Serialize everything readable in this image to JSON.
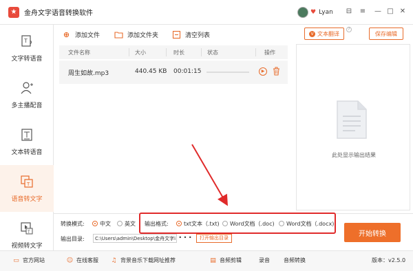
{
  "app": {
    "logo_text": "★",
    "title": "金舟文字语音转换软件",
    "user_name": "Lyan"
  },
  "window_controls": {
    "skin": "⊟",
    "menu": "≡",
    "minimize": "—",
    "maximize": "□",
    "close": "✕"
  },
  "sidebar": {
    "items": [
      {
        "label": "文字转语音",
        "icon": "text-to-speech-icon"
      },
      {
        "label": "多主播配音",
        "icon": "multi-speaker-icon"
      },
      {
        "label": "文本转语音",
        "icon": "document-to-speech-icon"
      },
      {
        "label": "语音转文字",
        "icon": "speech-to-text-icon",
        "active": true
      },
      {
        "label": "视频转文字",
        "icon": "video-to-text-icon"
      }
    ]
  },
  "toolbar": {
    "add_file": "添加文件",
    "add_folder": "添加文件夹",
    "clear_list": "清空列表",
    "text_translate": "文本翻译",
    "save_edit": "保存编辑"
  },
  "table": {
    "headers": [
      "文件名称",
      "大小",
      "时长",
      "状态",
      "操作"
    ],
    "rows": [
      {
        "name": "周生如故.mp3",
        "size": "440.45 KB",
        "duration": "00:01:15",
        "progress": 0
      }
    ]
  },
  "preview": {
    "placeholder": "此处显示输出结果"
  },
  "options": {
    "mode_label": "转换模式:",
    "mode_options": [
      "中文",
      "英文"
    ],
    "mode_selected": "中文",
    "format_label": "输出格式:",
    "format_options": [
      "txt文本（.txt)",
      "Word文档（.doc)",
      "Word文档（.docx)"
    ],
    "format_selected": "txt文本（.txt)",
    "output_dir_label": "输出目录:",
    "output_dir_value": "C:\\Users\\admin\\Desktop\\金舟文字i",
    "browse": "• • •",
    "open_dir": "打开输出目录"
  },
  "start_button": "开始转换",
  "footer": {
    "official_site": "官方网站",
    "online_service": "在线客服",
    "bg_music": "背景音乐下载网址推荐",
    "audio_edit": "音频剪辑",
    "record": "录音",
    "audio_convert": "音频转换",
    "version": "版本：v2.5.0"
  },
  "colors": {
    "accent": "#ee6f2a",
    "highlight_box": "#e02a2a",
    "arrow": "#e02a2a"
  }
}
